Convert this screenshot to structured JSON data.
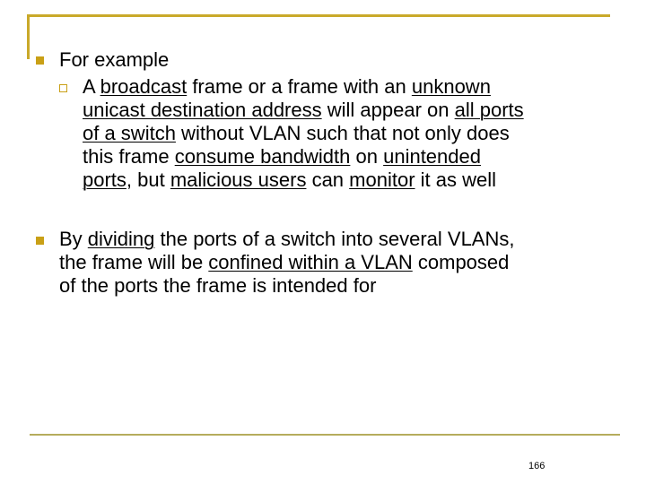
{
  "slide": {
    "colors": {
      "accent": "#c9a92a",
      "bullet": "#c9a016",
      "footer_rule": "#b5ac5c"
    },
    "bullets": [
      {
        "level": 1,
        "bullet_icon": "filled-square",
        "lines": [
          [
            {
              "text": "For example",
              "u": false
            }
          ]
        ]
      },
      {
        "level": 2,
        "bullet_icon": "hollow-square",
        "lines": [
          [
            {
              "text": "A ",
              "u": false
            },
            {
              "text": "broadcast",
              "u": true
            },
            {
              "text": " frame or a frame with an ",
              "u": false
            },
            {
              "text": "unknown",
              "u": true
            }
          ],
          [
            {
              "text": "unicast destination address",
              "u": true
            },
            {
              "text": " will appear on ",
              "u": false
            },
            {
              "text": "all ports",
              "u": true
            }
          ],
          [
            {
              "text": "of a switch",
              "u": true
            },
            {
              "text": " without VLAN such that not only does",
              "u": false
            }
          ],
          [
            {
              "text": "this frame ",
              "u": false
            },
            {
              "text": "consume bandwidth",
              "u": true
            },
            {
              "text": " on ",
              "u": false
            },
            {
              "text": "unintended",
              "u": true
            }
          ],
          [
            {
              "text": "ports",
              "u": true
            },
            {
              "text": ", but ",
              "u": false
            },
            {
              "text": "malicious users",
              "u": true
            },
            {
              "text": " can ",
              "u": false
            },
            {
              "text": "monitor",
              "u": true
            },
            {
              "text": " it as well",
              "u": false
            }
          ]
        ]
      },
      {
        "level": 1,
        "bullet_icon": "filled-square",
        "lines": [
          [
            {
              "text": "By ",
              "u": false
            },
            {
              "text": "dividing",
              "u": true
            },
            {
              "text": " the ports of a switch into several VLANs,",
              "u": false
            }
          ],
          [
            {
              "text": "the frame will be ",
              "u": false
            },
            {
              "text": "confined within a VLAN",
              "u": true
            },
            {
              "text": " composed",
              "u": false
            }
          ],
          [
            {
              "text": "of the ports the frame is intended for",
              "u": false
            }
          ]
        ]
      }
    ],
    "page_number": "166"
  }
}
